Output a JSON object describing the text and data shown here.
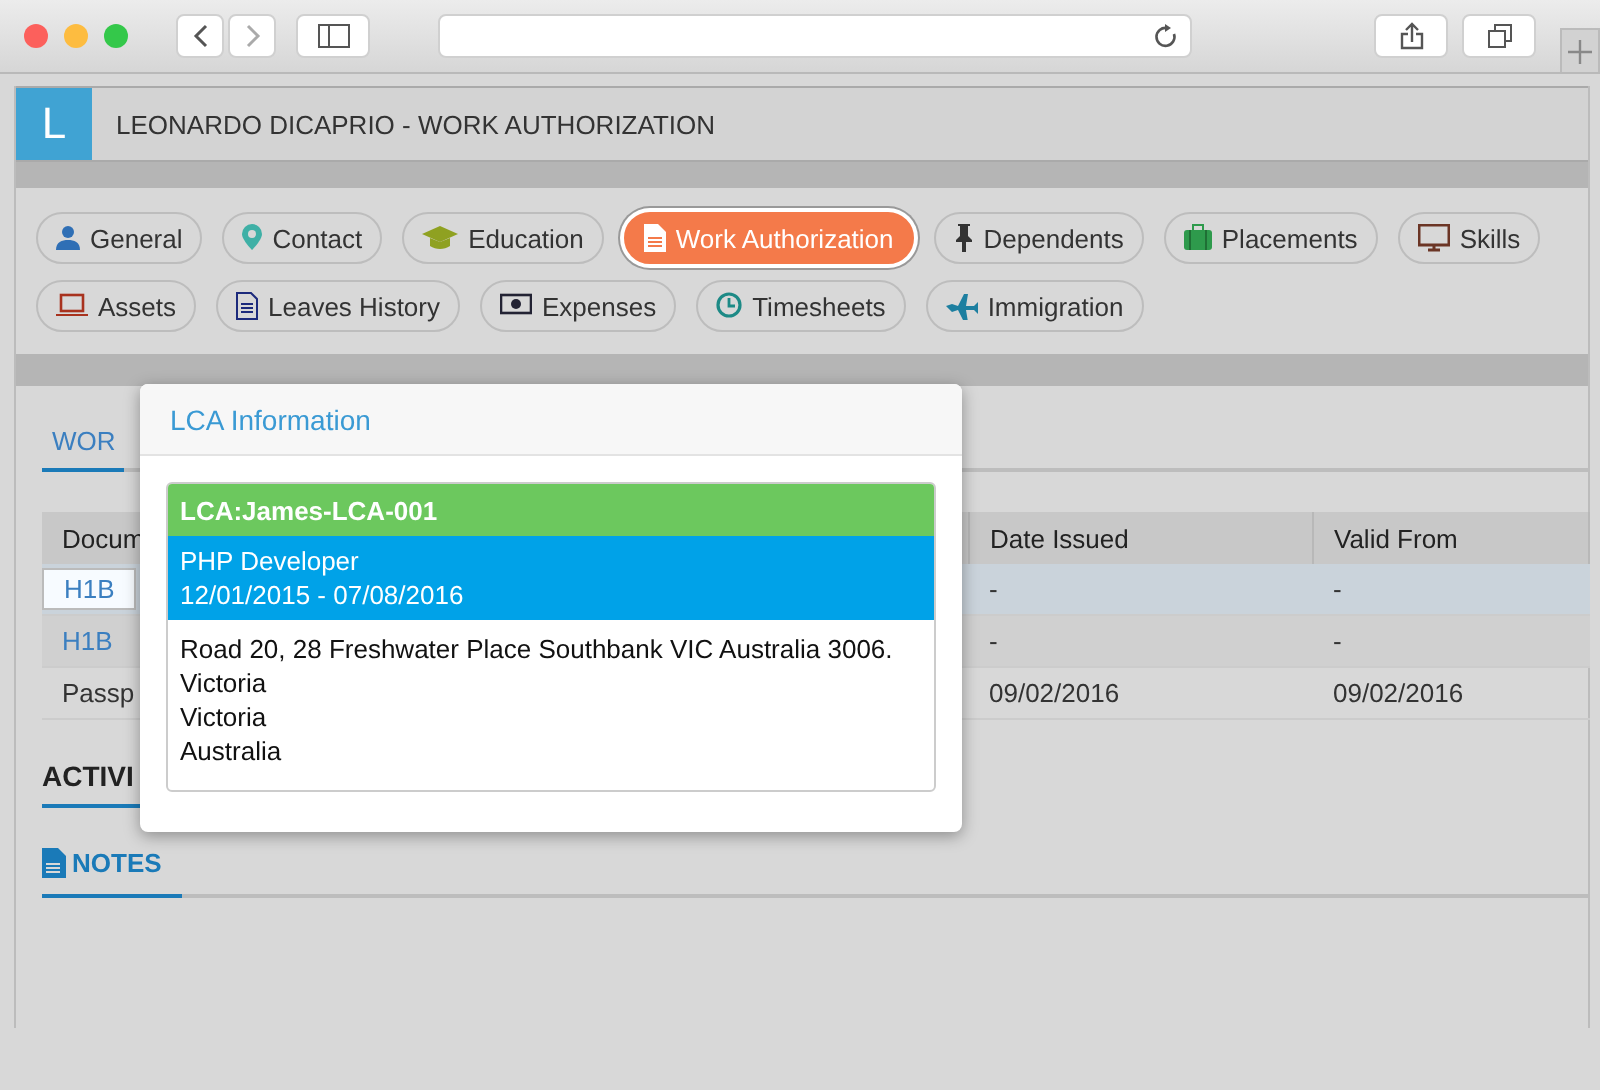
{
  "header": {
    "initial": "L",
    "title": "LEONARDO DICAPRIO - WORK AUTHORIZATION"
  },
  "tabs": [
    {
      "label": "General",
      "selected": false
    },
    {
      "label": "Contact",
      "selected": false
    },
    {
      "label": "Education",
      "selected": false
    },
    {
      "label": "Work Authorization",
      "selected": true
    },
    {
      "label": "Dependents",
      "selected": false
    },
    {
      "label": "Placements",
      "selected": false
    },
    {
      "label": "Skills",
      "selected": false
    },
    {
      "label": "Assets",
      "selected": false
    },
    {
      "label": "Leaves History",
      "selected": false
    },
    {
      "label": "Expenses",
      "selected": false
    },
    {
      "label": "Timesheets",
      "selected": false
    },
    {
      "label": "Immigration",
      "selected": false
    }
  ],
  "section_tab": {
    "label": "WOR"
  },
  "table": {
    "columns": [
      "Docum",
      "Date Issued",
      "Valid From"
    ],
    "rows": [
      {
        "cells": [
          "H1B",
          "-",
          "-"
        ],
        "link": true,
        "selected": true
      },
      {
        "cells": [
          "H1B",
          "-",
          "-"
        ],
        "link": true,
        "selected": false
      },
      {
        "cells": [
          "Passp",
          "09/02/2016",
          "09/02/2016"
        ],
        "link": false,
        "selected": false
      }
    ]
  },
  "activities": {
    "label": "ACTIVI"
  },
  "notes": {
    "label": "NOTES"
  },
  "popover": {
    "title": "LCA Information",
    "lca": "LCA:James-LCA-001",
    "position": "PHP Developer",
    "dates": "12/01/2015 - 07/08/2016",
    "address_lines": [
      "Road 20, 28 Freshwater Place Southbank VIC Australia 3006.",
      "Victoria",
      "Victoria",
      "Australia"
    ]
  }
}
